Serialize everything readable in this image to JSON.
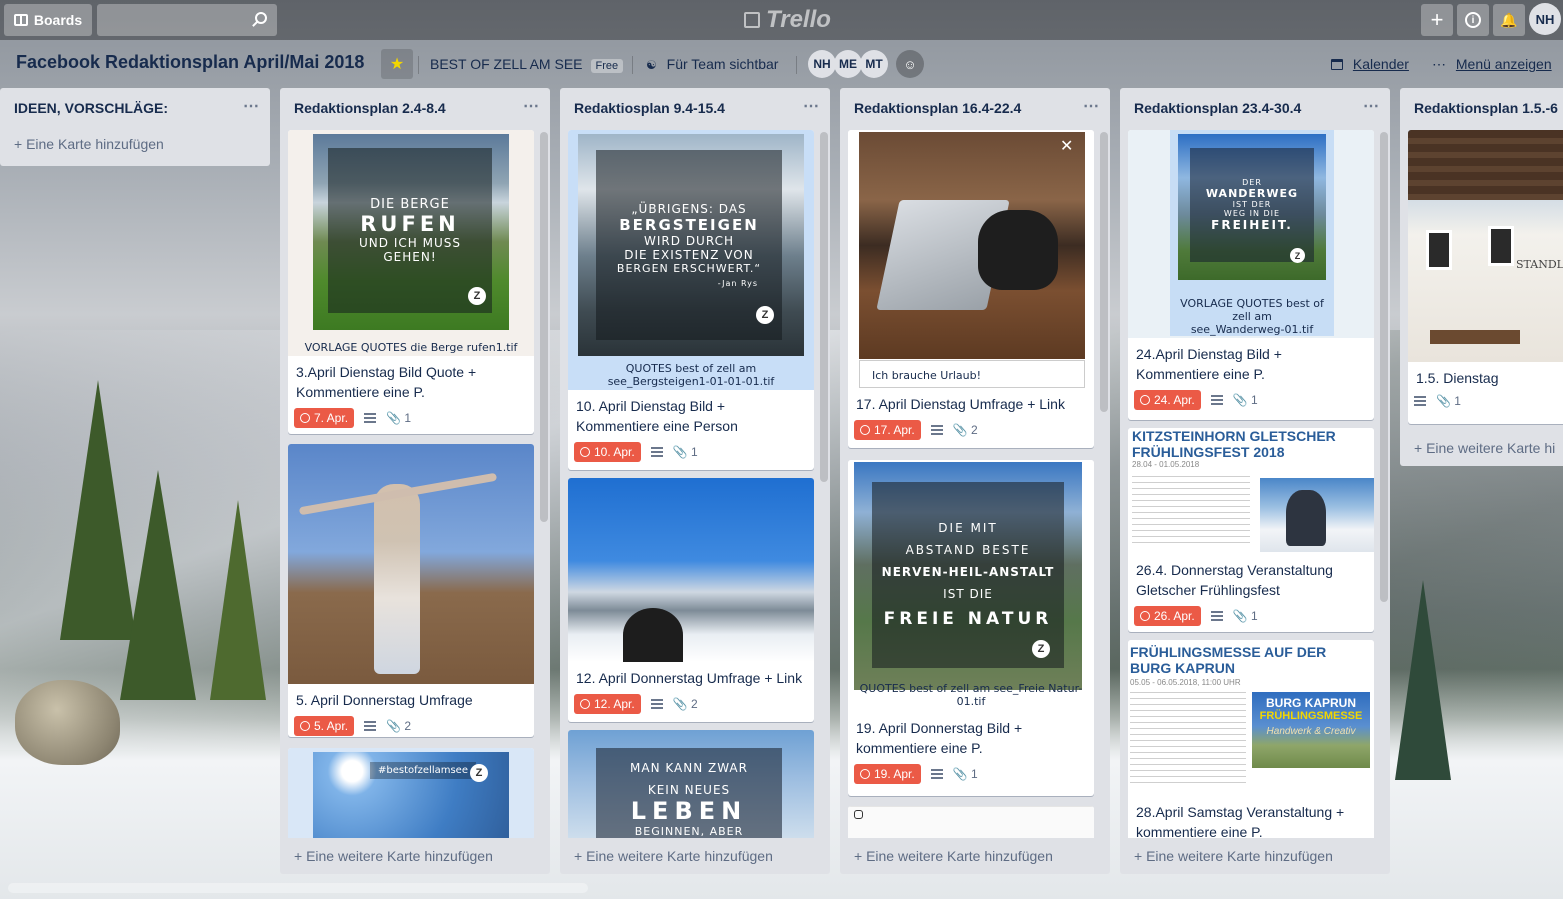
{
  "topbar": {
    "boards_label": "Boards",
    "logo_text": "Trello",
    "user_initials": "NH"
  },
  "board": {
    "title": "Facebook Redaktionsplan April/Mai 2018",
    "team": "BEST OF ZELL AM SEE",
    "plan": "Free",
    "visibility": "Für Team sichtbar",
    "members": [
      "NH",
      "ME",
      "MT"
    ],
    "calendar_label": "Kalender",
    "menu_label": "Menü anzeigen"
  },
  "colors": {
    "due_red": "#eb5a46",
    "list_bg": "#dfe1e6",
    "star_yellow": "#f2d600"
  },
  "lists": [
    {
      "title": "IDEEN, VORSCHLÄGE:",
      "add_label": "+ Eine Karte hinzufügen"
    },
    {
      "title": "Redaktionsplan 2.4-8.4",
      "add_label": "+ Eine weitere Karte hinzufügen",
      "cards": [
        {
          "quote_lines": [
            "DIE BERGE",
            "RUFEN",
            "UND ICH MUSS",
            "GEHEN!"
          ],
          "caption": "VORLAGE QUOTES die Berge rufen1.tif",
          "title": "3.April Dienstag Bild Quote + Kommentiere eine P.",
          "due": "7. Apr.",
          "attachments": "1"
        },
        {
          "title": "5. April Donnerstag Umfrage",
          "due": "5. Apr.",
          "attachments": "2"
        },
        {
          "quote_lines": [
            "#bestofzellamsee"
          ]
        }
      ]
    },
    {
      "title": "Redaktiosplan 9.4-15.4",
      "add_label": "+ Eine weitere Karte hinzufügen",
      "cards": [
        {
          "quote_lines": [
            "„ÜBRIGENS: DAS",
            "BERGSTEIGEN",
            "WIRD DURCH",
            "DIE EXISTENZ VON",
            "BERGEN ERSCHWERT.“",
            "-Jan Rys"
          ],
          "caption_lines": [
            "QUOTES best of zell am",
            "see_Bergsteigen1-01-01-01.tif"
          ],
          "title": "10. April Dienstag Bild + Kommentiere eine Person",
          "due": "10. Apr.",
          "attachments": "1"
        },
        {
          "title": "12. April Donnerstag Umfrage + Link",
          "due": "12. Apr.",
          "attachments": "2"
        },
        {
          "quote_lines": [
            "MAN KANN ZWAR",
            "KEIN NEUES",
            "LEBEN",
            "BEGINNEN, ABER"
          ]
        }
      ]
    },
    {
      "title": "Redaktionsplan 16.4-22.4",
      "add_label": "+ Eine weitere Karte hinzufügen",
      "cards": [
        {
          "caption": "Ich brauche Urlaub!",
          "title": "17. April Dienstag Umfrage + Link",
          "due": "17. Apr.",
          "attachments": "2"
        },
        {
          "quote_lines": [
            "DIE MIT",
            "ABSTAND BESTE",
            "NERVEN-HEIL-ANSTALT",
            "IST DIE",
            "FREIE NATUR"
          ],
          "caption": "QUOTES best of zell am see_Freie Natur-01.tif",
          "title": "19. April Donnerstag Bild + kommentiere eine P.",
          "due": "19. Apr.",
          "attachments": "1"
        }
      ]
    },
    {
      "title": "Redaktionsplan 23.4-30.4",
      "add_label": "+ Eine weitere Karte hinzufügen",
      "cards": [
        {
          "quote_lines": [
            "DER",
            "WANDERWEG",
            "IST DER",
            "WEG IN DIE",
            "FREIHEIT."
          ],
          "caption_lines": [
            "VORLAGE QUOTES best of",
            "zell am",
            "see_Wanderweg-01.tif"
          ],
          "title": "24.April Dienstag Bild + Kommentiere eine P.",
          "due": "24. Apr.",
          "attachments": "1"
        },
        {
          "doc_title": "KITZSTEINHORN GLETSCHER FRÜHLINGSFEST 2018",
          "doc_date": "28.04 - 01.05.2018",
          "title": "26.4. Donnerstag Veranstaltung Gletscher Frühlingsfest",
          "due": "26. Apr.",
          "attachments": "1"
        },
        {
          "doc_title": "FRÜHLINGSMESSE AUF DER BURG KAPRUN",
          "doc_date": "05.05 - 06.05.2018, 11:00 UHR",
          "poster_lines": [
            "BURG KAPRUN",
            "FRÜHLINGSMESSE",
            "Handwerk & Creativ"
          ],
          "title": "28.April Samstag Veranstaltung + kommentiere eine P."
        }
      ]
    },
    {
      "title": "Redaktionsplan  1.5.-6",
      "add_label": "+ Eine weitere Karte hi",
      "cards": [
        {
          "sign": "STANDL",
          "title": "1.5. Dienstag",
          "attachments": "1"
        }
      ]
    }
  ]
}
